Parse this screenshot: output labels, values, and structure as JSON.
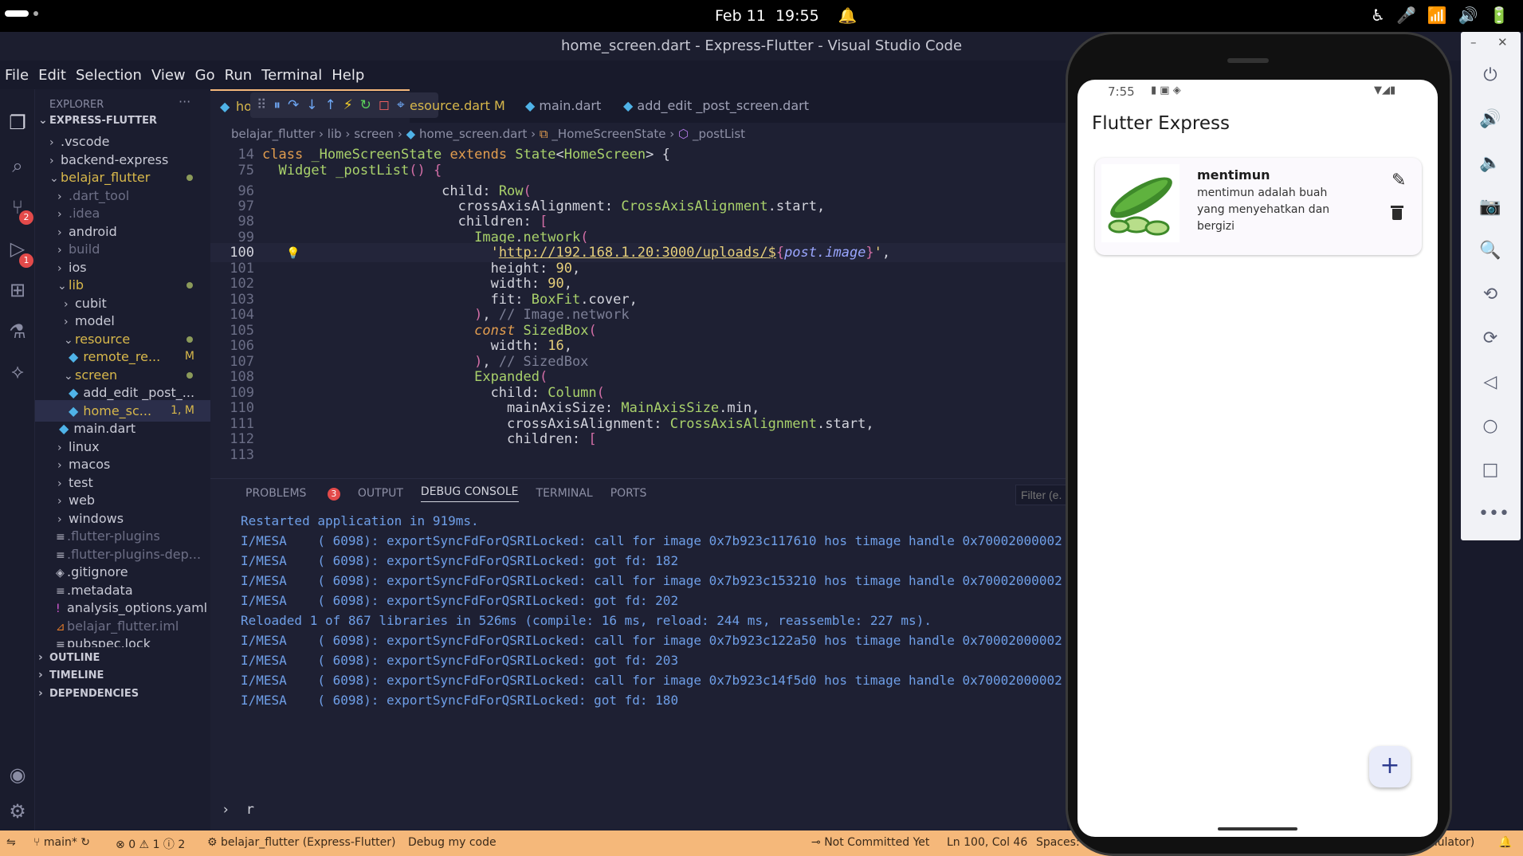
{
  "system": {
    "date": "Feb 11",
    "time": "19:55"
  },
  "window_title": "home_screen.dart - Express-Flutter - Visual Studio Code",
  "menu": [
    "File",
    "Edit",
    "Selection",
    "View",
    "Go",
    "Run",
    "Terminal",
    "Help"
  ],
  "activity_badges": {
    "source_control": "2",
    "debug": "1"
  },
  "explorer": {
    "title": "EXPLORER",
    "root": "EXPRESS-FLUTTER",
    "items": [
      ".vscode",
      "backend-express",
      "belajar_flutter",
      ".dart_tool",
      ".idea",
      "android",
      "build",
      "ios",
      "lib",
      "cubit",
      "model",
      "resource",
      "remote_re...",
      "add_edit _post_...",
      "home_sc...",
      "main.dart",
      "linux",
      "macos",
      "test",
      "web",
      "windows",
      ".flutter-plugins",
      ".flutter-plugins-dep...",
      ".gitignore",
      ".metadata",
      "analysis_options.yaml",
      "belajar_flutter.iml",
      "pubspec.lock"
    ],
    "marks": {
      "remote": "M",
      "home": "1, M"
    },
    "sections": [
      "OUTLINE",
      "TIMELINE",
      "DEPENDENCIES"
    ]
  },
  "tabs": [
    "ho",
    "esource.dart",
    "M",
    "main.dart",
    "add_edit _post_screen.dart"
  ],
  "breadcrumb": [
    "belajar_flutter",
    "lib",
    "screen",
    "home_screen.dart",
    "_HomeScreenState",
    "_postList"
  ],
  "code": {
    "line_numbers": [
      "14",
      "75",
      "96",
      "97",
      "98",
      "99",
      "100",
      "101",
      "102",
      "103",
      "104",
      "105",
      "106",
      "107",
      "108",
      "109",
      "110",
      "111",
      "112",
      "113"
    ]
  },
  "panel": {
    "tabs": [
      "PROBLEMS",
      "OUTPUT",
      "DEBUG CONSOLE",
      "TERMINAL",
      "PORTS"
    ],
    "problems_count": "3",
    "filter_placeholder": "Filter (e.",
    "console": [
      "Restarted application in 919ms.",
      "I/MESA    ( 6098): exportSyncFdForQSRILocked: call for image 0x7b923c117610 hos timage handle 0x70002000002",
      "I/MESA    ( 6098): exportSyncFdForQSRILocked: got fd: 182",
      "I/MESA    ( 6098): exportSyncFdForQSRILocked: call for image 0x7b923c153210 hos timage handle 0x70002000002",
      "I/MESA    ( 6098): exportSyncFdForQSRILocked: got fd: 202",
      "Reloaded 1 of 867 libraries in 526ms (compile: 16 ms, reload: 244 ms, reassemble: 227 ms).",
      "I/MESA    ( 6098): exportSyncFdForQSRILocked: call for image 0x7b923c122a50 hos timage handle 0x70002000002",
      "I/MESA    ( 6098): exportSyncFdForQSRILocked: got fd: 203",
      "I/MESA    ( 6098): exportSyncFdForQSRILocked: call for image 0x7b923c14f5d0 hos timage handle 0x70002000002",
      "I/MESA    ( 6098): exportSyncFdForQSRILocked: got fd: 180"
    ],
    "input": "r"
  },
  "status": {
    "branch": "main*",
    "errors": "0",
    "warnings": "1",
    "info": "2",
    "debug": "belajar_flutter (Express-Flutter)",
    "debug_my_code": "Debug my code",
    "commit": "Not Committed Yet",
    "position": "Ln 100, Col 46",
    "spaces": "Spaces: 2",
    "emulator": "mulator)"
  },
  "phone": {
    "time": "7:55",
    "app_title": "Flutter Express",
    "post": {
      "title": "mentimun",
      "body": "mentimun adalah buah yang menyehatkan dan bergizi"
    },
    "fab": "+"
  },
  "colors": {
    "accent": "#f5b87a",
    "bg": "#181a2b",
    "console": "#6f9fe8"
  }
}
